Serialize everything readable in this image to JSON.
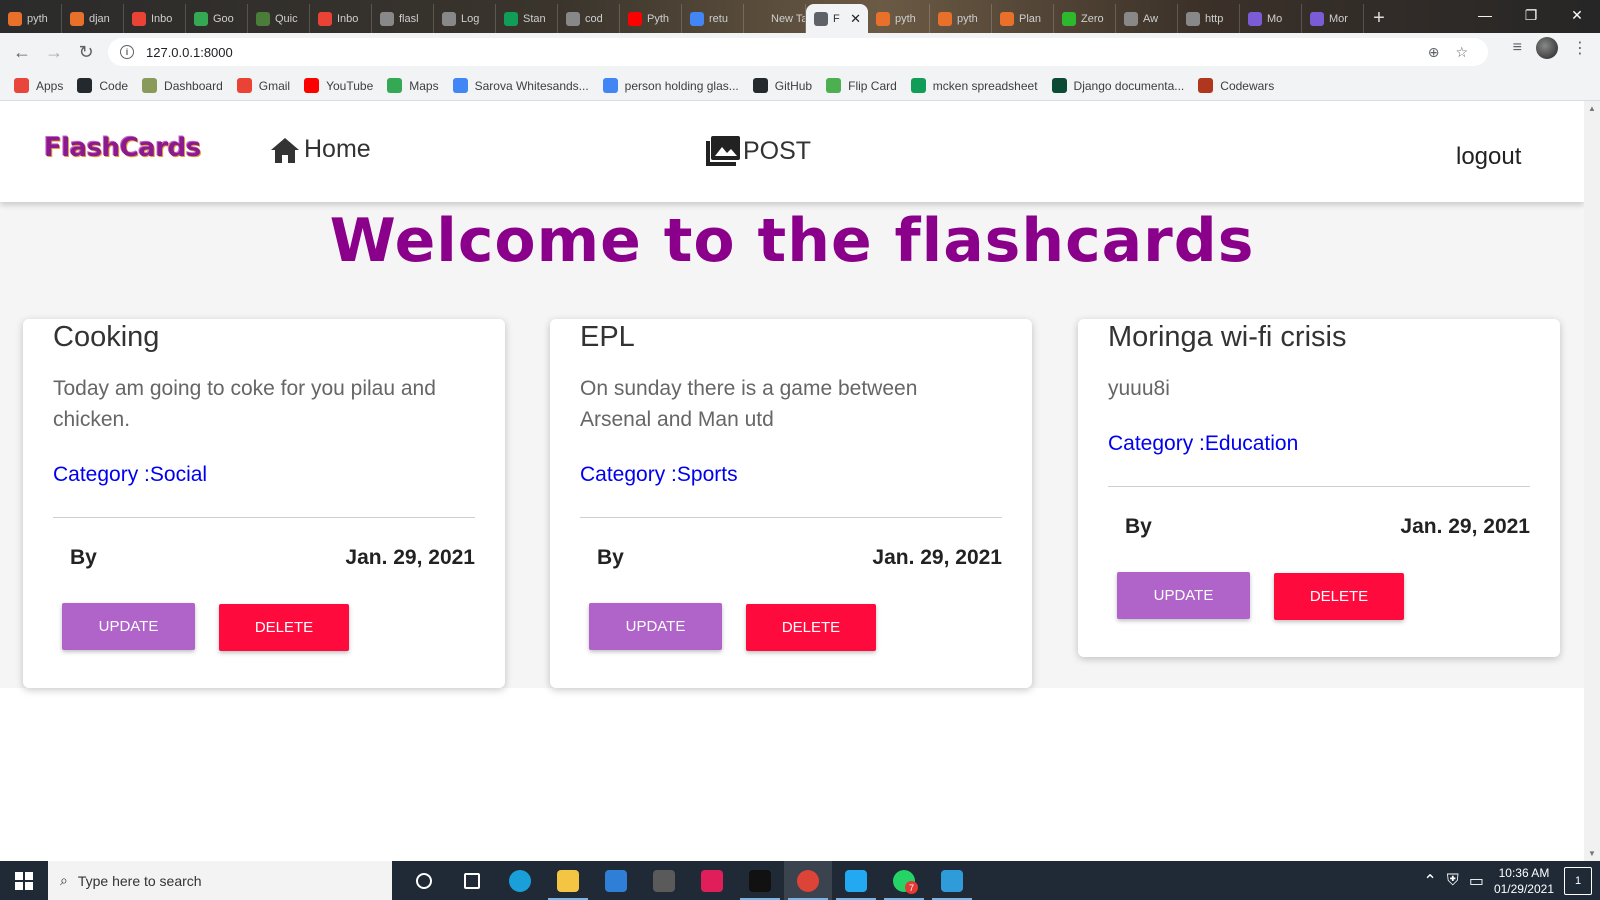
{
  "browser": {
    "tabs": [
      {
        "label": "pyth",
        "color": "#e8702a"
      },
      {
        "label": "djan",
        "color": "#e8702a"
      },
      {
        "label": "Inbo",
        "color": "#ea4335"
      },
      {
        "label": "Goo",
        "color": "#34a853"
      },
      {
        "label": "Quic",
        "color": "#4a7c3a"
      },
      {
        "label": "Inbo",
        "color": "#ea4335"
      },
      {
        "label": "flasl",
        "color": "#888888"
      },
      {
        "label": "Log",
        "color": "#888888"
      },
      {
        "label": "Stan",
        "color": "#0f9d58"
      },
      {
        "label": "cod",
        "color": "#888888"
      },
      {
        "label": "Pyth",
        "color": "#ff0000"
      },
      {
        "label": "retu",
        "color": "#4285f4"
      },
      {
        "label": "New Tab",
        "color": "transparent"
      },
      {
        "label": "F",
        "color": "#5f6368",
        "active": true
      },
      {
        "label": "pyth",
        "color": "#e8702a"
      },
      {
        "label": "pyth",
        "color": "#e8702a"
      },
      {
        "label": "Plan",
        "color": "#e8702a"
      },
      {
        "label": "Zero",
        "color": "#2eb82e"
      },
      {
        "label": "Aw",
        "color": "#888888"
      },
      {
        "label": "http",
        "color": "#888888"
      },
      {
        "label": "Mo",
        "color": "#7b5cd6"
      },
      {
        "label": "Mor",
        "color": "#7b5cd6"
      }
    ],
    "close_glyph": "✕",
    "new_tab_glyph": "+",
    "window_controls": {
      "minimize": "—",
      "restore": "❐",
      "close": "✕"
    },
    "url": "127.0.0.1:8000",
    "bookmarks": [
      {
        "label": "Apps",
        "icon": "apps-grid-icon",
        "color": "#e8453c"
      },
      {
        "label": "Code",
        "icon": "github-icon",
        "color": "#24292e"
      },
      {
        "label": "Dashboard",
        "icon": "palm-icon",
        "color": "#8a9a5b"
      },
      {
        "label": "Gmail",
        "icon": "gmail-icon",
        "color": "#ea4335"
      },
      {
        "label": "YouTube",
        "icon": "youtube-icon",
        "color": "#ff0000"
      },
      {
        "label": "Maps",
        "icon": "maps-pin-icon",
        "color": "#34a853"
      },
      {
        "label": "Sarova Whitesands...",
        "icon": "google-icon",
        "color": "#4285f4"
      },
      {
        "label": "person holding glas...",
        "icon": "google-icon",
        "color": "#4285f4"
      },
      {
        "label": "GitHub",
        "icon": "github-icon",
        "color": "#24292e"
      },
      {
        "label": "Flip Card",
        "icon": "w3schools-icon",
        "color": "#4caf50"
      },
      {
        "label": "mcken spreadsheet",
        "icon": "sheets-icon",
        "color": "#0f9d58"
      },
      {
        "label": "Django documenta...",
        "icon": "django-icon",
        "color": "#0c4b33"
      },
      {
        "label": "Codewars",
        "icon": "codewars-icon",
        "color": "#b1361e"
      }
    ]
  },
  "site": {
    "brand": "FlashCards",
    "nav": {
      "home": "Home",
      "post": "POST",
      "logout": "logout"
    },
    "hero": "Welcome to the flashcards",
    "cards": [
      {
        "title": "Cooking",
        "text": "Today am going to coke for you pilau and chicken.",
        "category": "Category :Social",
        "by": "By",
        "date": "Jan. 29, 2021",
        "update_label": "UPDATE",
        "delete_label": "DELETE"
      },
      {
        "title": "EPL",
        "text": "On sunday there is a game between Arsenal and Man utd",
        "category": "Category :Sports",
        "by": "By",
        "date": "Jan. 29, 2021",
        "update_label": "UPDATE",
        "delete_label": "DELETE"
      },
      {
        "title": "Moringa wi-fi crisis",
        "text": "yuuu8i",
        "category": "Category :Education",
        "by": "By",
        "date": "Jan. 29, 2021",
        "update_label": "UPDATE",
        "delete_label": "DELETE"
      }
    ],
    "colors": {
      "brand": "#8b1a8e",
      "hero": "#8b008b",
      "category": "#0000ee",
      "update": "#b063c9",
      "delete": "#ff0a3d"
    }
  },
  "taskbar": {
    "search_placeholder": "Type here to search",
    "apps": [
      {
        "name": "task-view",
        "color": "#ffffff"
      },
      {
        "name": "widgets",
        "color": "#ffffff"
      },
      {
        "name": "edge",
        "color": "#1aa0d8"
      },
      {
        "name": "file-explorer",
        "color": "#f4c542"
      },
      {
        "name": "mail",
        "color": "#2f7fd6"
      },
      {
        "name": "store",
        "color": "#5a5a5a"
      },
      {
        "name": "slack",
        "color": "#e01e5a"
      },
      {
        "name": "terminal",
        "color": "#111111"
      },
      {
        "name": "chrome",
        "color": "#db4437"
      },
      {
        "name": "vscode",
        "color": "#23a9f2"
      },
      {
        "name": "whatsapp",
        "color": "#25d366"
      },
      {
        "name": "photos",
        "color": "#2f9bd8"
      }
    ],
    "whatsapp_badge": "7",
    "time": "10:36 AM",
    "date": "01/29/2021",
    "notifications": "1"
  }
}
